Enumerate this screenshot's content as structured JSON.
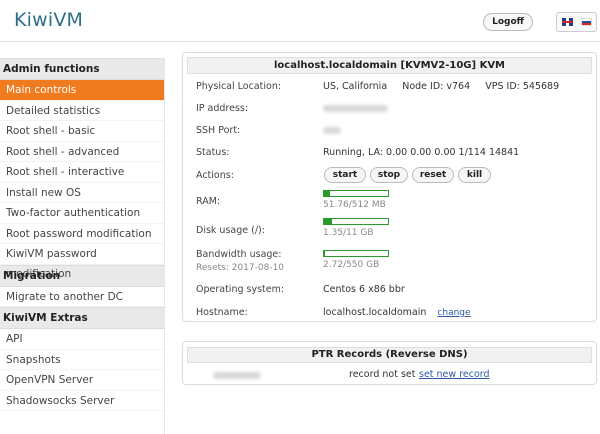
{
  "header": {
    "logo": "KiwiVM",
    "logoff_label": "Logoff",
    "languages": [
      "English",
      "Russian"
    ]
  },
  "sidebar": {
    "sections": [
      {
        "title": "Admin functions",
        "items": [
          "Main controls",
          "Detailed statistics",
          "Root shell - basic",
          "Root shell - advanced",
          "Root shell - interactive",
          "Install new OS",
          "Two-factor authentication",
          "Root password modification",
          "KiwiVM password modification"
        ],
        "active": "Main controls"
      },
      {
        "title": "Migration",
        "items": [
          "Migrate to another DC"
        ]
      },
      {
        "title": "KiwiVM Extras",
        "items": [
          "API",
          "Snapshots",
          "OpenVPN Server",
          "Shadowsocks Server"
        ]
      }
    ]
  },
  "vps": {
    "title": "localhost.localdomain   [KVMV2-10G]   KVM",
    "labels": {
      "location": "Physical Location:",
      "ip": "IP address:",
      "ssh": "SSH Port:",
      "status": "Status:",
      "actions": "Actions:",
      "ram": "RAM:",
      "disk": "Disk usage (/):",
      "bandwidth": "Bandwidth usage:",
      "os": "Operating system:",
      "hostname": "Hostname:"
    },
    "location_value": "US, California     Node ID: v764     VPS ID: 545689",
    "status_value": "Running, LA: 0.00 0.00 0.00 1/114 14841",
    "actions": [
      "start",
      "stop",
      "reset",
      "kill"
    ],
    "ram": {
      "text": "51.76/512 MB",
      "fraction": 0.1
    },
    "disk": {
      "text": "1.35/11 GB",
      "fraction": 0.12
    },
    "bandwidth": {
      "text": "2.72/550 GB",
      "fraction": 0.005,
      "resets": "Resets: 2017-08-10"
    },
    "os_value": "Centos 6 x86 bbr",
    "hostname_value": "localhost.localdomain",
    "hostname_change": "change"
  },
  "ptr": {
    "title": "PTR Records (Reverse DNS)",
    "status": "record not set",
    "action": "set new record"
  }
}
